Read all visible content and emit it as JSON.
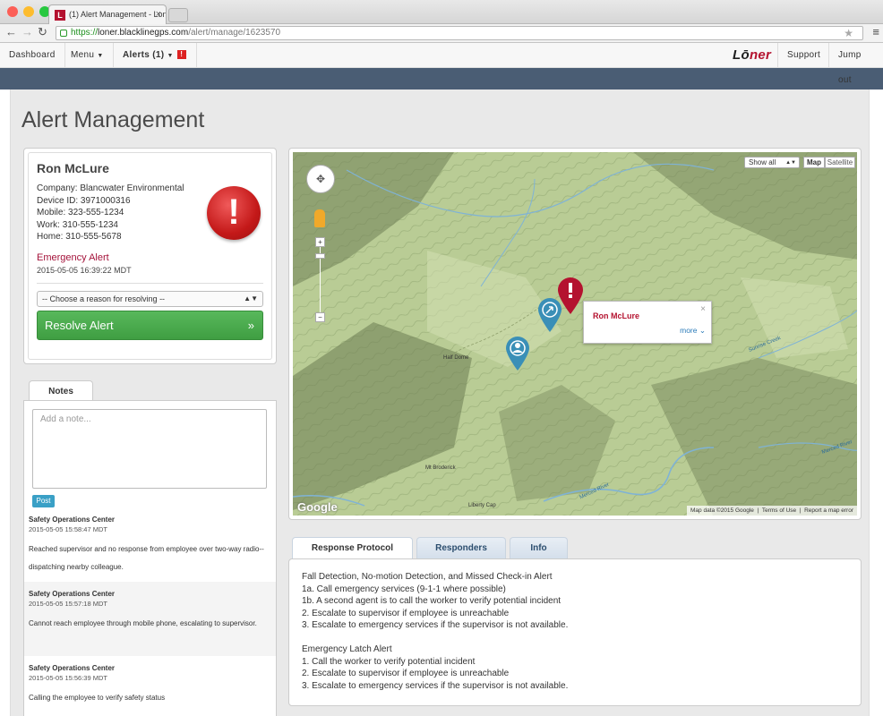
{
  "browser": {
    "tab_title": "(1) Alert Management - Lon",
    "favicon_letter": "L",
    "url_scheme": "https://",
    "url_domain": "loner.blacklinegps.com",
    "url_path": "/alert/manage/1623570"
  },
  "nav": {
    "dashboard": "Dashboard",
    "menu": "Menu",
    "alerts": "Alerts (1)",
    "alerts_badge": "!",
    "brand_pre": "L",
    "brand_o": "ō",
    "brand_post": "ner",
    "support": "Support",
    "jump_out": "Jump out"
  },
  "page": {
    "title": "Alert Management"
  },
  "person": {
    "name": "Ron McLure",
    "company": "Company: Blancwater Environmental",
    "device": "Device ID: 3971000316",
    "mobile": "Mobile: 323-555-1234",
    "work": "Work: 310-555-1234",
    "home": "Home: 310-555-5678",
    "alert_type": "Emergency Alert",
    "alert_time": "2015-05-05 16:39:22 MDT",
    "alert_icon": "exclamation-icon",
    "reason_placeholder": "-- Choose a reason for resolving --",
    "resolve_label": "Resolve Alert",
    "resolve_chevron": "»"
  },
  "notes": {
    "tab_label": "Notes",
    "placeholder": "Add a note...",
    "post_label": "Post",
    "items": [
      {
        "author": "Safety Operations Center",
        "time": "2015-05-05 15:58:47 MDT",
        "text": "Reached supervisor and no response from employee over two-way radio--dispatching nearby colleague."
      },
      {
        "author": "Safety Operations Center",
        "time": "2015-05-05 15:57:18 MDT",
        "text": "Cannot reach employee through mobile phone, escalating to supervisor."
      },
      {
        "author": "Safety Operations Center",
        "time": "2015-05-05 15:56:39 MDT",
        "text": "Calling the employee to verify safety status"
      }
    ]
  },
  "map": {
    "show_select": "Show all",
    "map_btn": "Map",
    "satellite_btn": "Satellite",
    "zoom_in": "+",
    "zoom_out": "−",
    "popup_name": "Ron McLure",
    "popup_close": "×",
    "popup_more": "more",
    "labels": {
      "half_dome": "Half Dome",
      "mt_broderick": "Mt Broderick",
      "liberty_cap": "Liberty Cap",
      "merced_river_1": "Merced River",
      "merced_river_2": "Merced River",
      "sunrise_creek": "Sunrise Creek"
    },
    "google": "Google",
    "attribution_data": "Map data ©2015 Google",
    "attribution_terms": "Terms of Use",
    "attribution_report": "Report a map error"
  },
  "protocol": {
    "tabs": [
      "Response Protocol",
      "Responders",
      "Info"
    ],
    "section1_title": "Fall Detection, No-motion Detection, and Missed Check-in Alert",
    "section1_lines": [
      "1a. Call emergency services (9-1-1 where possible)",
      "1b. A second agent is to call the worker to verify potential incident",
      "2. Escalate to supervisor if employee is unreachable",
      "3. Escalate to emergency services if the supervisor is not available."
    ],
    "section2_title": "Emergency Latch Alert",
    "section2_lines": [
      "1. Call the worker to verify potential incident",
      "2. Escalate to supervisor if employee is unreachable",
      "3. Escalate to emergency services if the supervisor is not available."
    ]
  },
  "colors": {
    "brand_red": "#b4122f",
    "resolve_green": "#4caf50",
    "banner": "#4a5d74",
    "map_terrain": "#b9cc95",
    "marker_blue": "#3a8fb7"
  }
}
